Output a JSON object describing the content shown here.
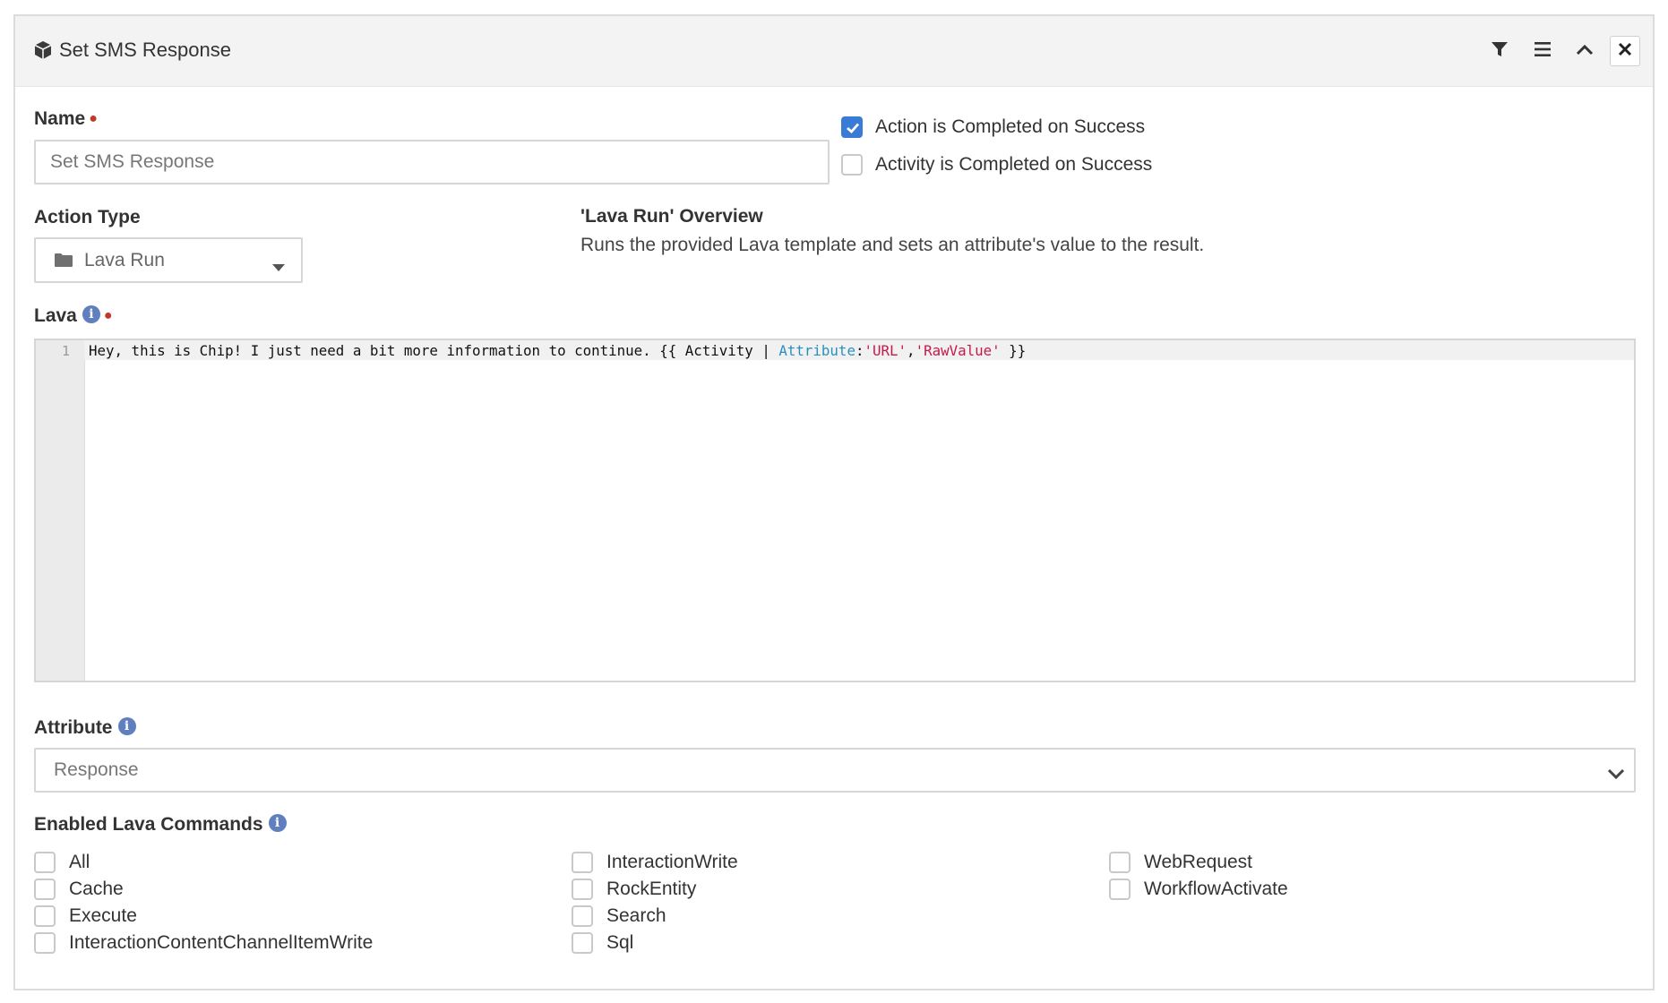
{
  "header": {
    "title": "Set SMS Response",
    "title_icon": "cube-icon",
    "buttons": [
      "filter-icon",
      "menu-icon",
      "chevron-up-icon",
      "close-icon"
    ]
  },
  "name_field": {
    "label": "Name",
    "value": "Set SMS Response"
  },
  "completion_options": [
    {
      "label": "Action is Completed on Success",
      "checked": true
    },
    {
      "label": "Activity is Completed on Success",
      "checked": false
    }
  ],
  "action_type": {
    "label": "Action Type",
    "value": "Lava Run",
    "icon": "folder-icon"
  },
  "overview": {
    "title": "'Lava Run' Overview",
    "text": "Runs the provided Lava template and sets an attribute's value to the result."
  },
  "lava": {
    "label": "Lava",
    "line_number": "1",
    "code_plain": "Hey, this is Chip! I just need a bit more information to continue. {{ Activity | ",
    "code_attr": "Attribute",
    "code_colon": ":",
    "code_str1": "'URL'",
    "code_comma": ",",
    "code_str2": "'RawValue'",
    "code_end": " }}"
  },
  "attribute": {
    "label": "Attribute",
    "value": "Response"
  },
  "lava_commands": {
    "label": "Enabled Lava Commands",
    "columns": [
      [
        "All",
        "Cache",
        "Execute",
        "InteractionContentChannelItemWrite"
      ],
      [
        "InteractionWrite",
        "RockEntity",
        "Search",
        "Sql"
      ],
      [
        "WebRequest",
        "WorkflowActivate"
      ]
    ]
  },
  "colors": {
    "accent": "#3a7bd5",
    "required": "#c0392b",
    "info": "#5f7fbf"
  }
}
